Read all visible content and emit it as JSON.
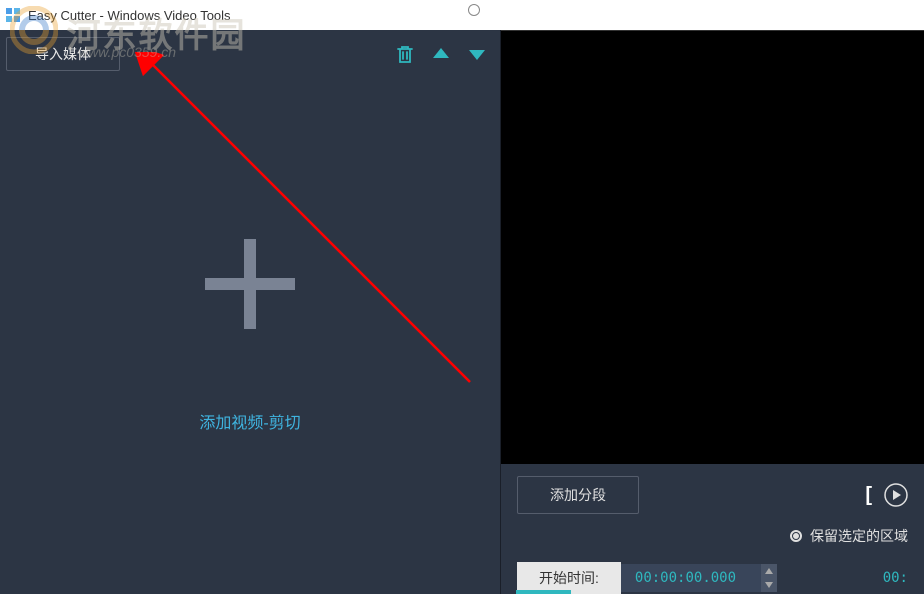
{
  "titlebar": {
    "app_title": "Easy Cutter - Windows Video Tools"
  },
  "watermark": {
    "text": "河东软件园",
    "url": "www.pc0359.cn"
  },
  "toolbar": {
    "import_label": "导入媒体",
    "icons": {
      "delete": "trash-icon",
      "move_up": "triangle-up-icon",
      "move_down": "triangle-down-icon"
    }
  },
  "media_area": {
    "add_video_text": "添加视频-剪切"
  },
  "controls": {
    "add_segment_label": "添加分段",
    "bracket_left": "[",
    "keep_selected_label": "保留选定的区域",
    "start_time_label": "开始时间:",
    "start_time_value": "00:00:00.000",
    "end_time_partial": "00:"
  }
}
